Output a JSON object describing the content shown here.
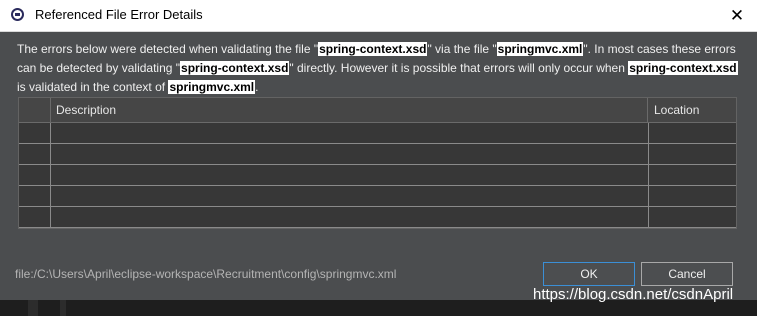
{
  "window": {
    "title": "Referenced File Error Details",
    "close_label": "✕"
  },
  "message": {
    "p1": "The errors below were detected when validating the file \"",
    "file1": "spring-context.xsd",
    "p2": "\" via the file \"",
    "file2": "springmvc.xml",
    "p3": "\".  In most cases these errors can be detected by validating \"",
    "file3": "spring-context.xsd",
    "p4": "\" directly.  However it is possible that errors will only occur when ",
    "file4": "spring-context.xsd",
    "p5": " is validated in the context of ",
    "file5": "springmvc.xml",
    "p6": "."
  },
  "table": {
    "columns": [
      "",
      "Description",
      "Location"
    ],
    "rows": [
      {
        "description": "",
        "location": ""
      },
      {
        "description": "",
        "location": ""
      },
      {
        "description": "",
        "location": ""
      },
      {
        "description": "",
        "location": ""
      },
      {
        "description": "",
        "location": ""
      }
    ]
  },
  "footer": {
    "file_path": "file:/C:\\Users\\April\\eclipse-workspace\\Recruitment\\config\\springmvc.xml",
    "ok_label": "OK",
    "cancel_label": "Cancel"
  },
  "watermark": "https://blog.csdn.net/csdnApril"
}
